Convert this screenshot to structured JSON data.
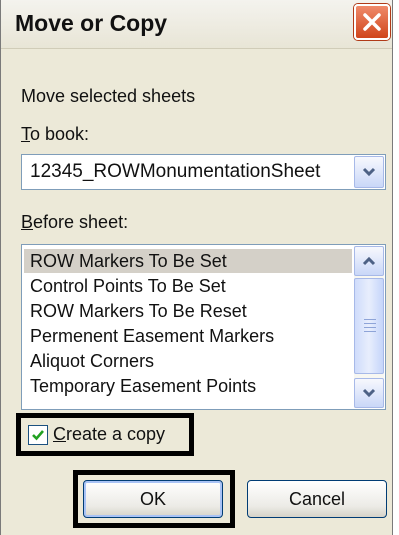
{
  "dialog": {
    "title": "Move or Copy",
    "move_label": "Move selected sheets",
    "to_book_label_ul": "T",
    "to_book_label_rest": "o book:",
    "book_value": "12345_ROWMonumentationSheet",
    "before_sheet_label_ul": "B",
    "before_sheet_label_rest": "efore sheet:",
    "sheets": [
      {
        "label": "ROW Markers To Be Set",
        "selected": true
      },
      {
        "label": "Control Points To Be Set",
        "selected": false
      },
      {
        "label": "ROW Markers To Be Reset",
        "selected": false
      },
      {
        "label": "Permenent Easement Markers",
        "selected": false
      },
      {
        "label": "Aliquot Corners",
        "selected": false
      },
      {
        "label": "Temporary Easement Points",
        "selected": false
      }
    ],
    "create_copy_ul": "C",
    "create_copy_rest": "reate a copy",
    "create_copy_checked": true,
    "ok_label": "OK",
    "cancel_label": "Cancel"
  },
  "icons": {
    "close": "close-icon",
    "dropdown": "chevron-down-icon",
    "scroll_up": "chevron-up-icon",
    "scroll_down": "chevron-down-icon",
    "check": "checkmark-icon"
  },
  "colors": {
    "dialog_bg": "#ece9d8",
    "close_red": "#d0451b",
    "checkmark_green": "#21a121",
    "highlight_border": "#000000"
  }
}
